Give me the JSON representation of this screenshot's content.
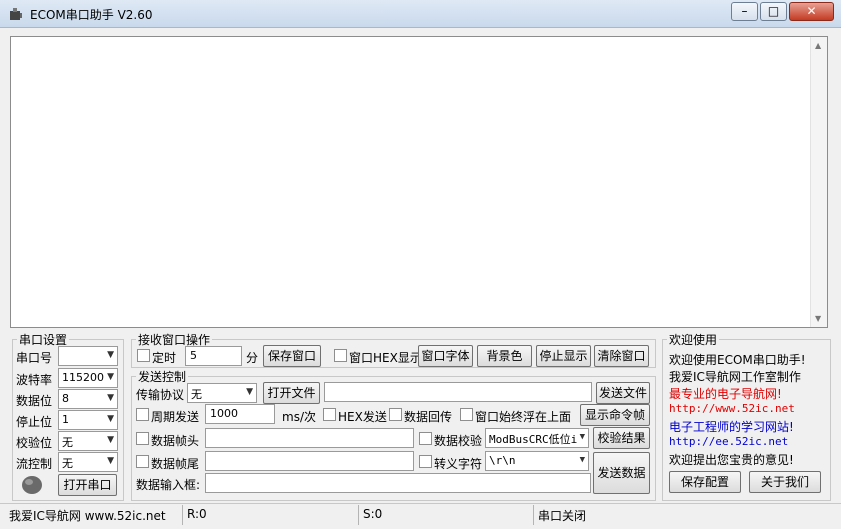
{
  "window": {
    "title": "ECOM串口助手   V2.60",
    "controls": [
      "–",
      "□",
      "✕"
    ]
  },
  "serial": {
    "legend": "串口设置",
    "port_label": "串口号",
    "port_value": "",
    "baud_label": "波特率",
    "baud_value": "115200",
    "data_label": "数据位",
    "data_value": "8",
    "stop_label": "停止位",
    "stop_value": "1",
    "parity_label": "校验位",
    "parity_value": "无",
    "flow_label": "流控制",
    "flow_value": "无",
    "open_button": "打开串口"
  },
  "recv": {
    "legend": "接收窗口操作",
    "timer_label": "定时",
    "timer_value": "5",
    "timer_unit": "分",
    "save_button": "保存窗口",
    "hex_label": "窗口HEX显示",
    "font_button": "窗口字体",
    "bg_button": "背景色",
    "stop_button": "停止显示",
    "clear_button": "清除窗口"
  },
  "send": {
    "legend": "发送控制",
    "protocol_label": "传输协议",
    "protocol_value": "无",
    "open_file_button": "打开文件",
    "file_path": "",
    "send_file_button": "发送文件",
    "period_label": "周期发送",
    "period_value": "1000",
    "period_unit": "ms/次",
    "hex_send_label": "HEX发送",
    "echo_label": "数据回传",
    "ontop_label": "窗口始终浮在上面",
    "show_frame_button": "显示命令帧",
    "frame_head_label": "数据帧头",
    "check_label": "数据校验",
    "check_value": "ModBusCRC低位i",
    "check_result_button": "校验结果",
    "frame_tail_label": "数据帧尾",
    "escape_label": "转义字符",
    "escape_value": "\\r\\n",
    "input_label": "数据输入框:",
    "send_data_button": "发送数据"
  },
  "welcome": {
    "legend": "欢迎使用",
    "line1": "欢迎使用ECOM串口助手!",
    "line2": "我爱IC导航网工作室制作",
    "line3": "最专业的电子导航网!",
    "line4": "http://www.52ic.net",
    "line5": "电子工程师的学习网站!",
    "line6": "http://ee.52ic.net",
    "line7": "欢迎提出您宝贵的意见!",
    "save_config_button": "保存配置",
    "about_button": "关于我们",
    "accent_red": "#e00000",
    "accent_blue": "#0000cc"
  },
  "statusbar": {
    "site": "我爱IC导航网 www.52ic.net",
    "rx": "R:0",
    "tx": "S:0",
    "port_state": "串口关闭"
  }
}
